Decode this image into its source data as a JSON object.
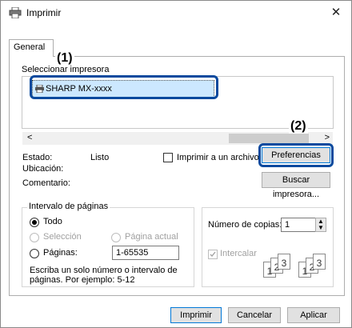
{
  "window": {
    "title": "Imprimir",
    "close_glyph": "✕"
  },
  "tabs": [
    {
      "label": "General"
    }
  ],
  "printer_select": {
    "label": "Seleccionar impresora",
    "items": [
      {
        "name": "SHARP MX-xxxx"
      }
    ],
    "scroll_left": "<",
    "scroll_right": ">"
  },
  "status": {
    "estado_label": "Estado:",
    "estado_value": "Listo",
    "ubicacion_label": "Ubicación:",
    "comentario_label": "Comentario:"
  },
  "print_to_file": {
    "label": "Imprimir a un archivo",
    "checked": false
  },
  "buttons": {
    "preferences": "Preferencias",
    "find_printer": "Buscar impresora...",
    "print": "Imprimir",
    "cancel": "Cancelar",
    "apply": "Aplicar"
  },
  "page_range": {
    "title": "Intervalo de páginas",
    "all": "Todo",
    "selection": "Selección",
    "current_page": "Página actual",
    "pages": "Páginas:",
    "pages_value": "1-65535",
    "help_line1": "Escriba un solo número o intervalo de",
    "help_line2": "páginas. Por ejemplo: 5-12"
  },
  "copies": {
    "label": "Número de copias:",
    "value": "1",
    "collate": "Intercalar",
    "collate_pages": [
      "1",
      "2",
      "3"
    ]
  },
  "callouts": {
    "one": "(1)",
    "two": "(2)"
  },
  "colors": {
    "callout": "#0a4a9e",
    "selection": "#cce8ff",
    "accent": "#0078d7"
  }
}
